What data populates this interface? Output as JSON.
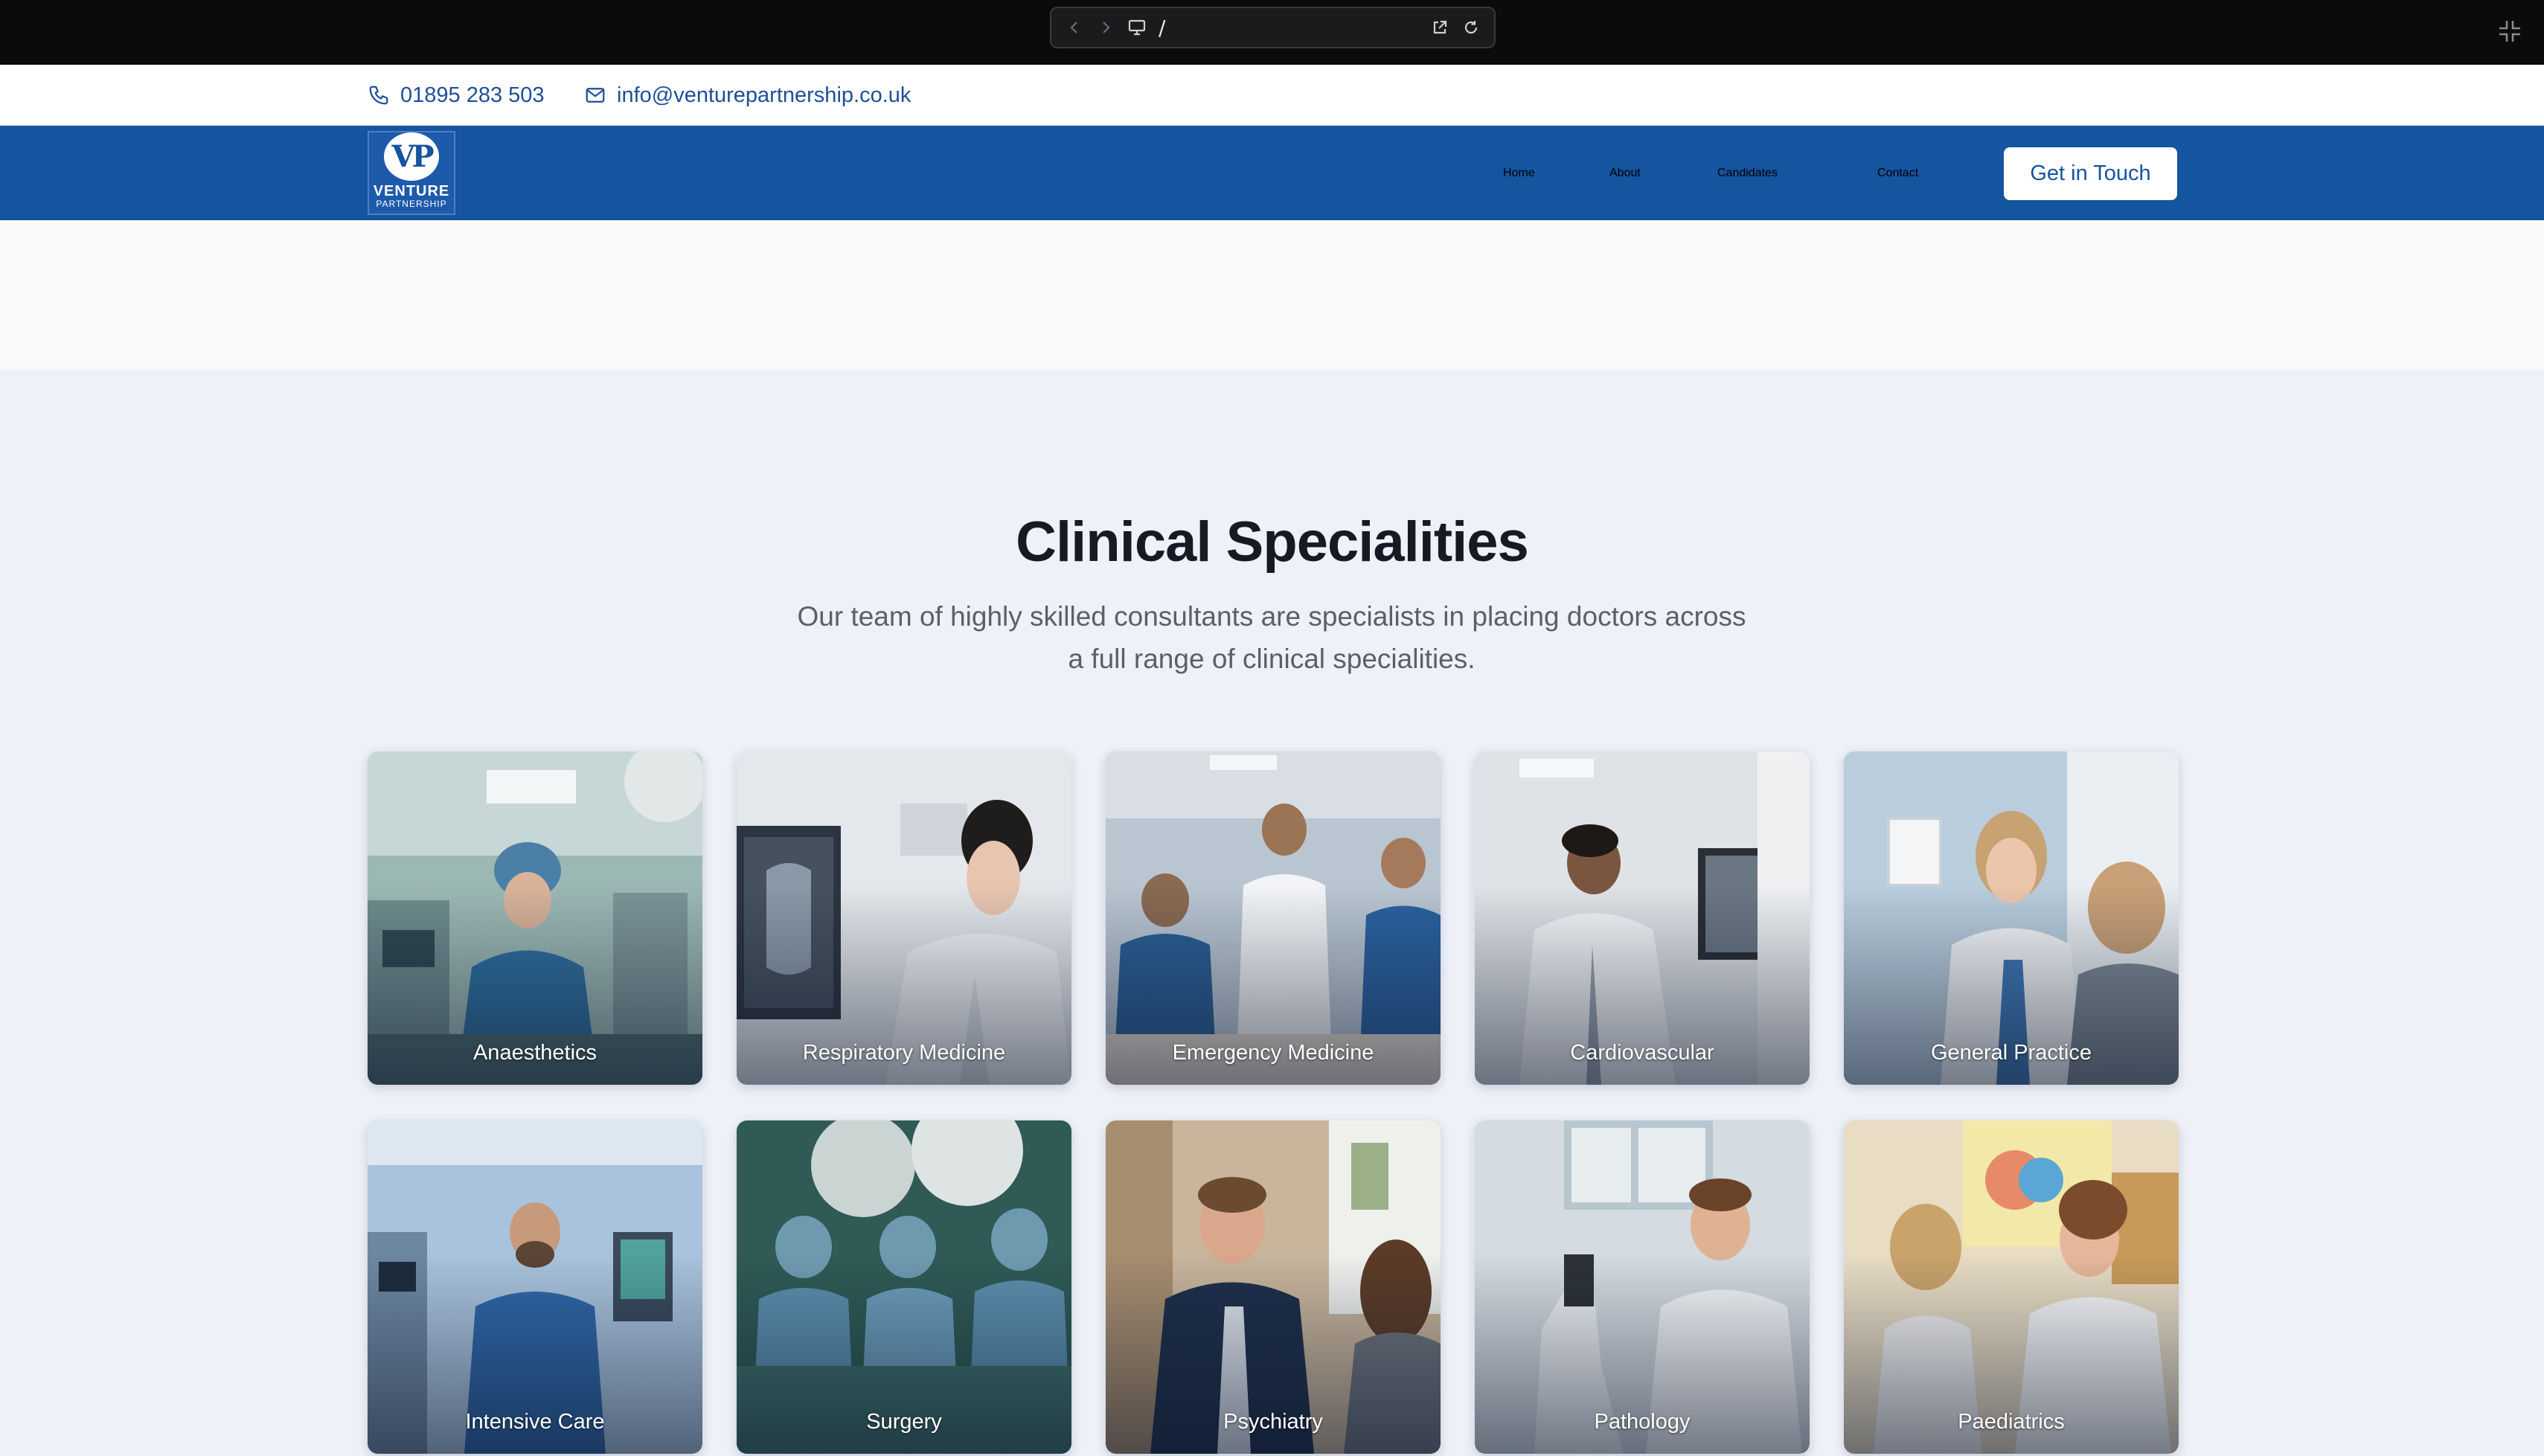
{
  "browser": {
    "path": "/",
    "icons": [
      "back-icon",
      "forward-icon",
      "monitor-icon",
      "open-external-icon",
      "reload-icon",
      "collapse-icon"
    ]
  },
  "contact": {
    "phone": "01895 283 503",
    "email": "info@venturepartnership.co.uk",
    "phone_icon": "phone-icon",
    "email_icon": "mail-icon"
  },
  "header": {
    "logo": {
      "line1": "VENTURE",
      "line2": "PARTNERSHIP"
    },
    "nav": [
      "Home",
      "About",
      "Candidates",
      "Contact"
    ],
    "cta": "Get in Touch",
    "background": "#15549f"
  },
  "section": {
    "title": "Clinical Specialities",
    "subtitle_line1": "Our team of highly skilled consultants are specialists in placing doctors across",
    "subtitle_line2": "a full range of clinical specialities."
  },
  "specialities": [
    {
      "label": "Anaesthetics"
    },
    {
      "label": "Respiratory Medicine"
    },
    {
      "label": "Emergency Medicine"
    },
    {
      "label": "Cardiovascular"
    },
    {
      "label": "General Practice"
    },
    {
      "label": "Intensive Care"
    },
    {
      "label": "Surgery"
    },
    {
      "label": "Psychiatry"
    },
    {
      "label": "Pathology"
    },
    {
      "label": "Paediatrics"
    }
  ]
}
